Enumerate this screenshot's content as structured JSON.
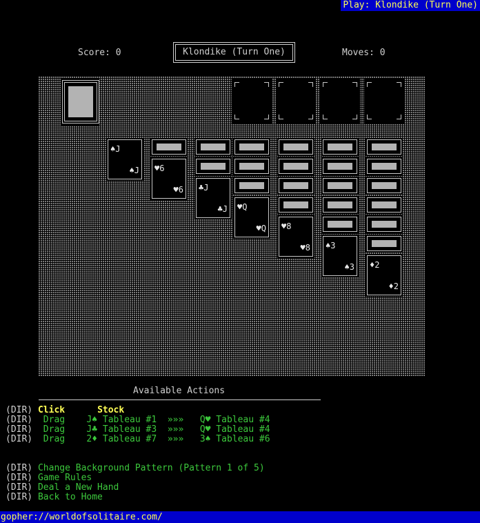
{
  "window": {
    "title": "Play: Klondike (Turn One)"
  },
  "header": {
    "score_label": "Score: 0",
    "game_title": "Klondike (Turn One)",
    "moves_label": "Moves: 0"
  },
  "board": {
    "background_pattern": "dotted",
    "tableau": [
      {
        "face_down": 0,
        "face_up": {
          "rank": "J",
          "suit": "♠"
        }
      },
      {
        "face_down": 1,
        "face_up": {
          "rank": "6",
          "suit": "♥"
        }
      },
      {
        "face_down": 2,
        "face_up": {
          "rank": "J",
          "suit": "♣"
        }
      },
      {
        "face_down": 3,
        "face_up": {
          "rank": "Q",
          "suit": "♥"
        }
      },
      {
        "face_down": 4,
        "face_up": {
          "rank": "8",
          "suit": "♥"
        }
      },
      {
        "face_down": 5,
        "face_up": {
          "rank": "3",
          "suit": "♠"
        }
      },
      {
        "face_down": 6,
        "face_up": {
          "rank": "2",
          "suit": "♦"
        }
      }
    ]
  },
  "actions": {
    "title": "Available Actions",
    "dir": "(DIR)",
    "rows": [
      {
        "a": "Click",
        "b": "Stock",
        "c": "",
        "d": "",
        "e": "",
        "f": "",
        "g": ""
      },
      {
        "a": "Drag",
        "b": "J♠",
        "c": "Tableau #1",
        "d": "»»»",
        "e": "Q♥",
        "f": "Tableau #4",
        "g": ""
      },
      {
        "a": "Drag",
        "b": "J♣",
        "c": "Tableau #3",
        "d": "»»»",
        "e": "Q♥",
        "f": "Tableau #4",
        "g": ""
      },
      {
        "a": "Drag",
        "b": "2♦",
        "c": "Tableau #7",
        "d": "»»»",
        "e": "3♠",
        "f": "Tableau #6",
        "g": ""
      }
    ],
    "links": [
      "Change Background Pattern (Pattern 1 of 5)",
      "Game Rules",
      "Deal a New Hand",
      "Back to Home"
    ]
  },
  "status_bar": {
    "url": "gopher://worldofsolitaire.com/"
  },
  "colors": {
    "background": "#000000",
    "link": "#3cc83c",
    "highlight": "#ffff55",
    "bar": "#0000cc"
  }
}
